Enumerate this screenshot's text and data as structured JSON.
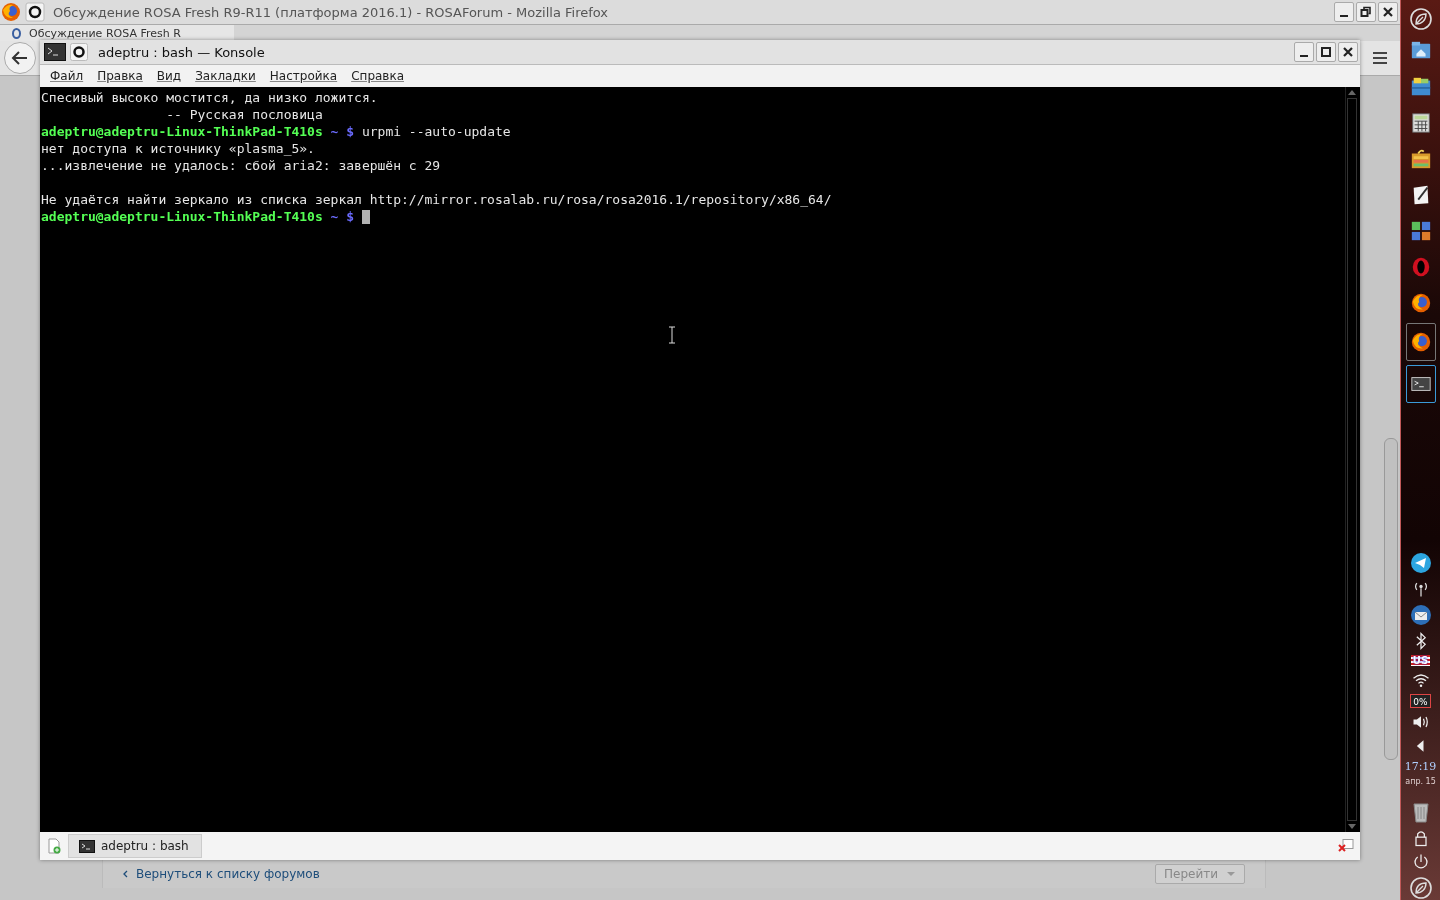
{
  "firefox": {
    "title": "Обсуждение ROSA Fresh R9-R11 (платформа 2016.1) - ROSAForum - Mozilla Firefox",
    "tab": {
      "label": "Обсуждение ROSA Fresh R"
    },
    "back_link": "Вернуться к списку форумов",
    "go_button": "Перейти"
  },
  "konsole": {
    "title": "adeptru : bash — Konsole",
    "menu": [
      "Файл",
      "Правка",
      "Вид",
      "Закладки",
      "Настройка",
      "Справка"
    ],
    "lines": [
      {
        "kind": "text",
        "text": "Спесивый высоко мостится, да низко ложится."
      },
      {
        "kind": "text",
        "text": "                -- Русская пословица"
      },
      {
        "kind": "prompt",
        "user": "adeptru@adeptru-Linux-ThinkPad-T410s",
        "path": "~",
        "symbol": "$",
        "command": "urpmi --auto-update",
        "cursor": false
      },
      {
        "kind": "text",
        "text": "нет доступа к источнику «plasma_5»."
      },
      {
        "kind": "text",
        "text": "...извлечение не удалось: сбой aria2: завершён с 29"
      },
      {
        "kind": "blank"
      },
      {
        "kind": "text",
        "text": "Не удаётся найти зеркало из списка зеркал http://mirror.rosalab.ru/rosa/rosa2016.1/repository/x86_64/"
      },
      {
        "kind": "prompt",
        "user": "adeptru@adeptru-Linux-ThinkPad-T410s",
        "path": "~",
        "symbol": "$",
        "cursor": true
      }
    ],
    "tabs": [
      {
        "label": "adeptru : bash",
        "selected": true
      }
    ]
  },
  "dock": {
    "launchers": [
      {
        "kind": "home-folder",
        "open": false,
        "selected": false
      },
      {
        "kind": "file-cabinet",
        "open": false,
        "selected": false
      },
      {
        "kind": "calculator",
        "open": false,
        "selected": false
      },
      {
        "kind": "archive",
        "open": false,
        "selected": false
      },
      {
        "kind": "text-editor",
        "open": false,
        "selected": false
      },
      {
        "kind": "office",
        "open": false,
        "selected": false
      },
      {
        "kind": "opera",
        "open": false,
        "selected": false
      },
      {
        "kind": "firefox",
        "open": false,
        "selected": false
      },
      {
        "kind": "firefox",
        "open": true,
        "selected": false
      },
      {
        "kind": "terminal",
        "open": true,
        "selected": true
      }
    ],
    "tray": {
      "layout": "US",
      "battery": "0%",
      "time": "17:19",
      "date": "апр. 15"
    }
  }
}
